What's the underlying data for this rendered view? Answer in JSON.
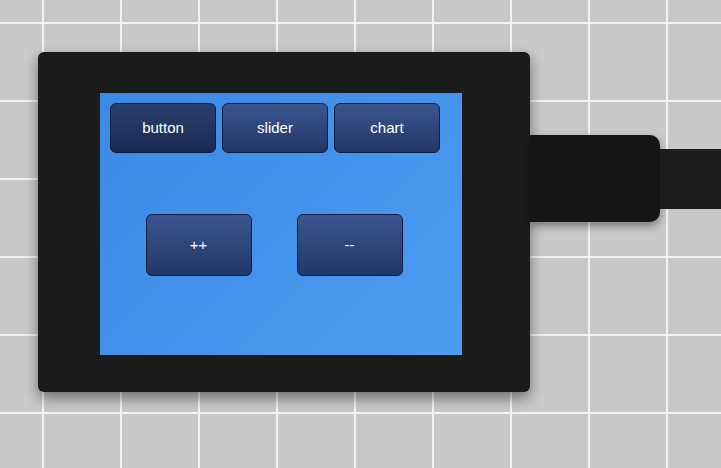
{
  "screen": {
    "tabs": [
      {
        "label": "button",
        "selected": true
      },
      {
        "label": "slider",
        "selected": false
      },
      {
        "label": "chart",
        "selected": false
      }
    ],
    "buttons": [
      "++",
      "--"
    ]
  }
}
